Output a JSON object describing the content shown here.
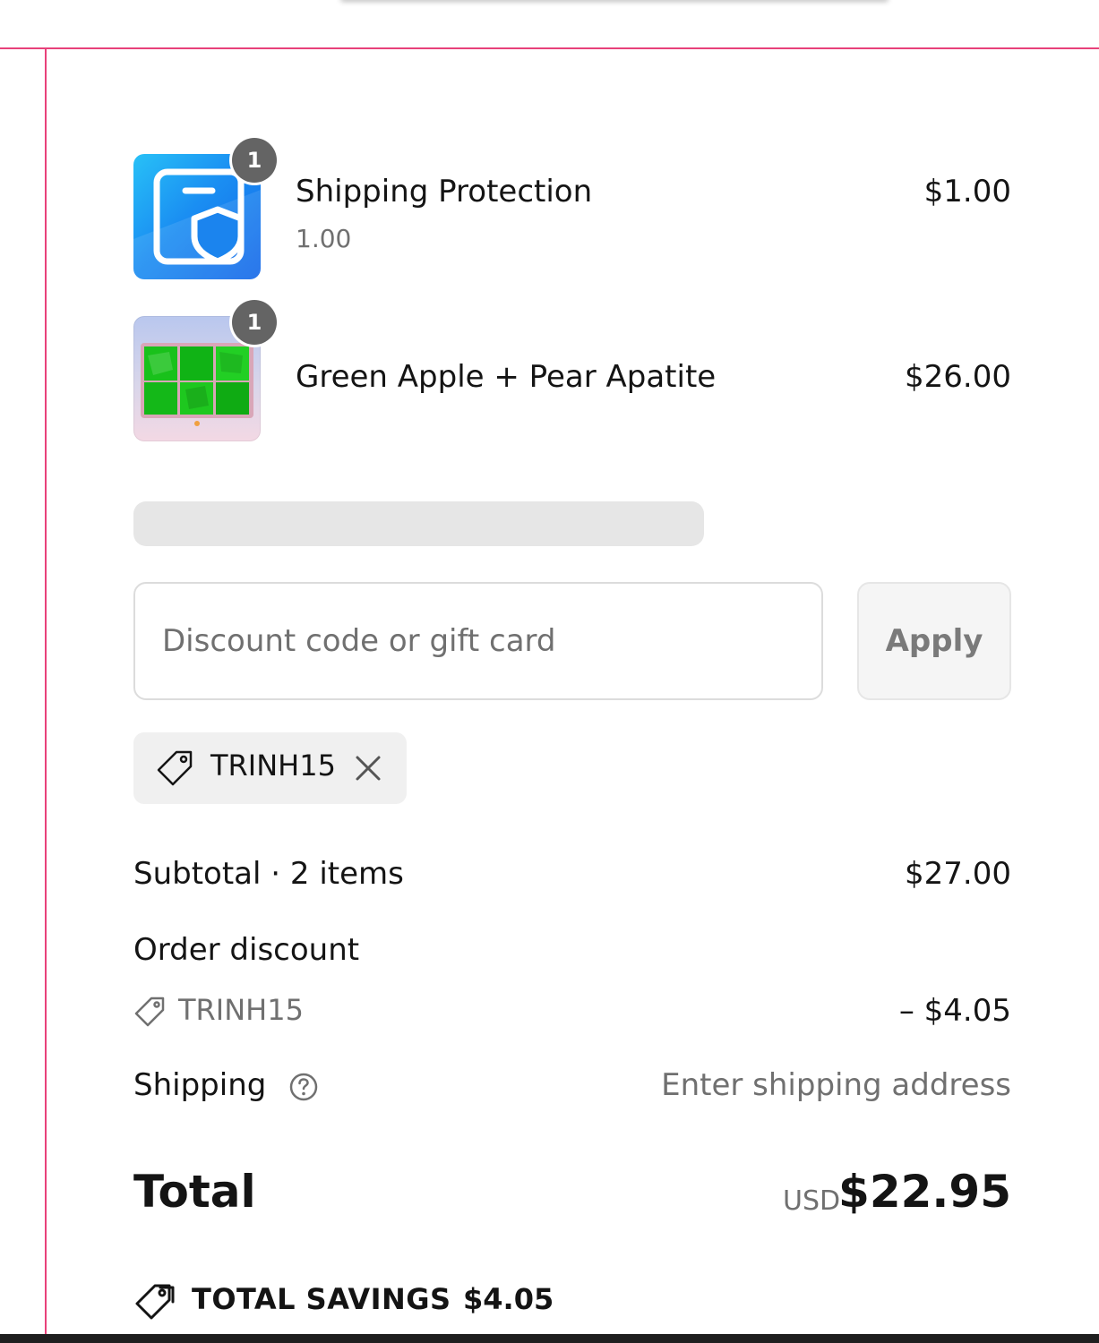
{
  "line_items": [
    {
      "name": "Shipping Protection",
      "variant": "1.00",
      "price": "$1.00",
      "quantity": "1",
      "icon": "shield-box-icon"
    },
    {
      "name": "Green Apple + Pear Apatite",
      "price": "$26.00",
      "quantity": "1",
      "icon": "product-photo"
    }
  ],
  "discount": {
    "placeholder": "Discount code or gift card",
    "apply_label": "Apply",
    "applied_code": "TRINH15"
  },
  "summary": {
    "subtotal_label": "Subtotal · 2 items",
    "subtotal_value": "$27.00",
    "order_discount_label": "Order discount",
    "discount_code": "TRINH15",
    "discount_value": "– $4.05",
    "shipping_label": "Shipping",
    "shipping_value": "Enter shipping address",
    "total_label": "Total",
    "currency": "USD",
    "total_value": "$22.95",
    "savings_label": "TOTAL SAVINGS",
    "savings_value": "$4.05"
  },
  "colors": {
    "frame_accent": "#e8417a",
    "badge_bg": "#646464",
    "text_primary": "#141414",
    "text_muted": "#707070"
  }
}
